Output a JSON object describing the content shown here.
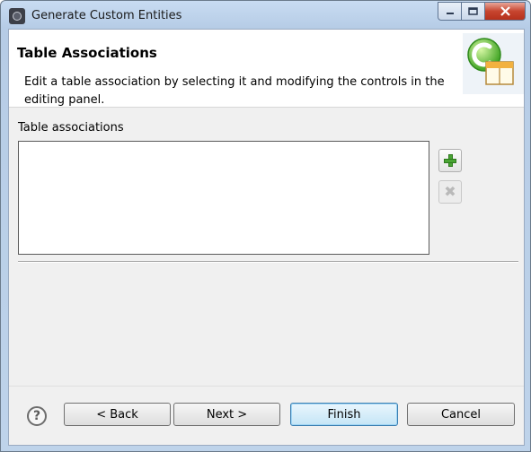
{
  "window": {
    "title": "Generate Custom Entities",
    "caption_buttons": {
      "minimize_icon": "minimize-icon",
      "maximize_icon": "maximize-icon",
      "close_icon": "close-icon"
    }
  },
  "header": {
    "title": "Table Associations",
    "description": "Edit a table association by selecting it and modifying the controls in the editing panel."
  },
  "content": {
    "section_label": "Table associations",
    "items": [],
    "add_icon": "add-icon",
    "remove_icon": "remove-icon"
  },
  "footer": {
    "help_symbol": "?",
    "back_label": "< Back",
    "next_label": "Next >",
    "finish_label": "Finish",
    "cancel_label": "Cancel"
  },
  "colors": {
    "accent": "#3c7fb1",
    "add_green": "#4aa534"
  }
}
